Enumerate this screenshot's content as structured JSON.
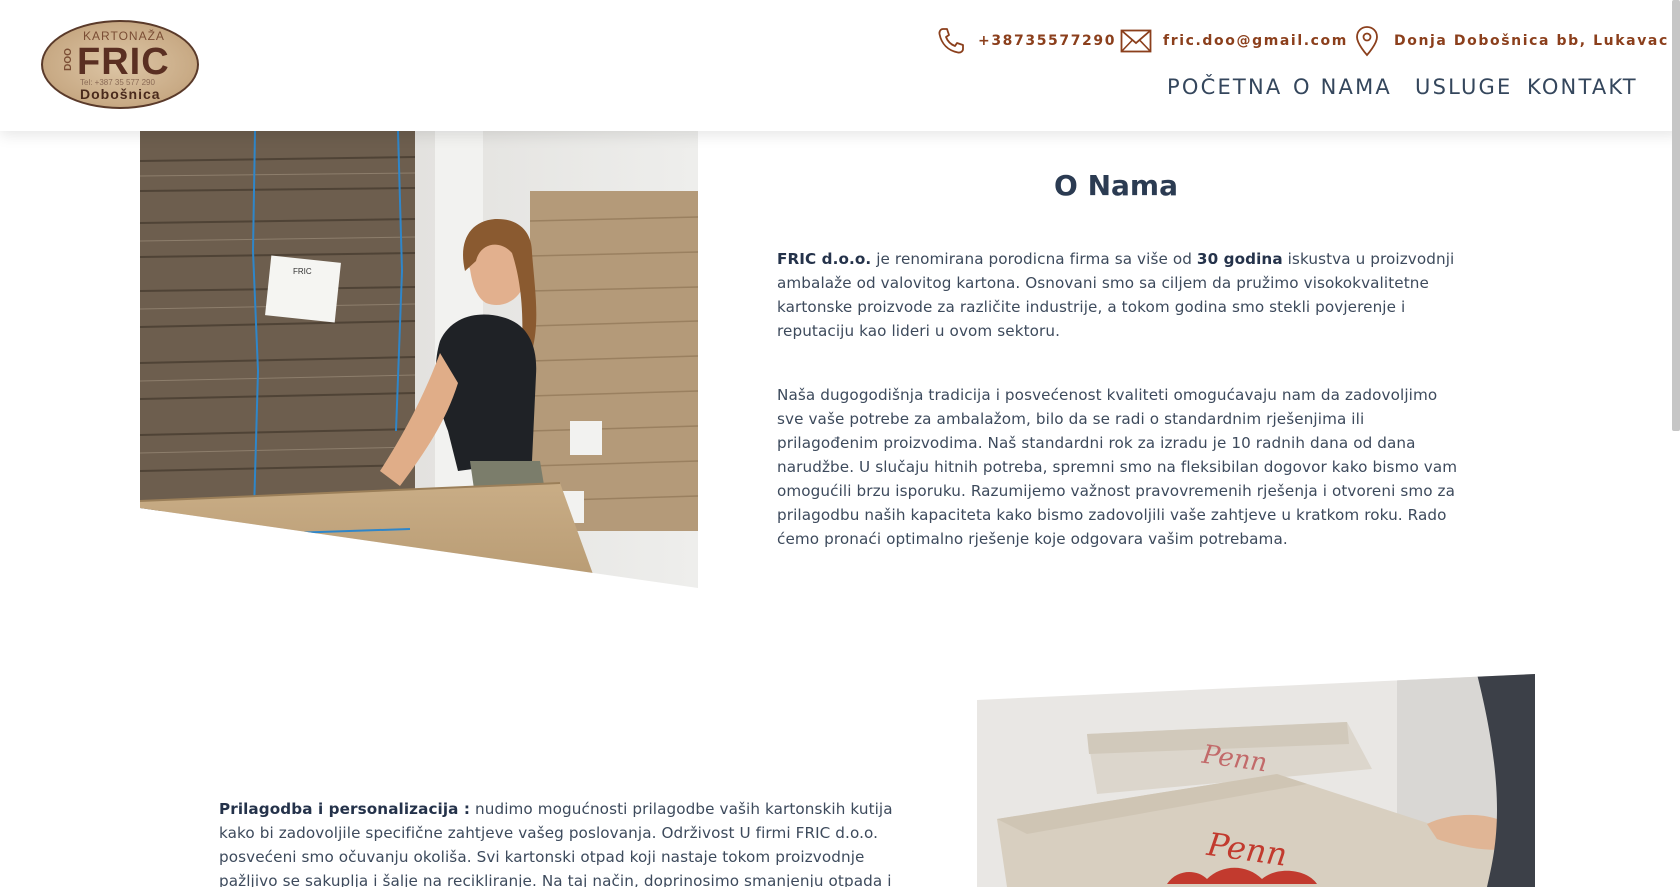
{
  "header": {
    "logo": {
      "top_text": "KARTONAŽA",
      "side_text": "DOO",
      "main_text": "FRIC",
      "tel_text": "Tel: +387 35 577 290",
      "bottom_text": "Dobošnica"
    },
    "contact": {
      "phone": "+38735577290",
      "email": "fric.doo@gmail.com",
      "address": "Donja Dobošnica bb, Lukavac"
    },
    "nav": [
      {
        "label": "POČETNA"
      },
      {
        "label": "O NAMA"
      },
      {
        "label": "USLUGE"
      },
      {
        "label": "KONTAKT"
      }
    ]
  },
  "about": {
    "title": "O Nama",
    "p1": {
      "company": "FRIC d.o.o.",
      "t1": " je renomirana porodicna firma sa više od ",
      "years": "30 godina",
      "t2": " iskustva u proizvodnji ambalaže od valovitog kartona. Osnovani smo sa ciljem da pružimo visokokvalitetne kartonske proizvode za različite industrije, a tokom godina smo stekli povjerenje i reputaciju kao lideri u ovom sektoru."
    },
    "p2": "Naša dugogodišnja tradicija i posvećenost kvaliteti omogućavaju nam da zadovoljimo sve vaše potrebe za ambalažom, bilo da se radi o standardnim rješenjima ili prilagođenim proizvodima. Naš standardni rok za izradu je 10 radnih dana od dana narudžbe. U slučaju hitnih potreba, spremni smo na fleksibilan dogovor kako bismo vam omogućili brzu isporuku. Razumijemo važnost pravovremenih rješenja i otvoreni smo za prilagodbu naših kapaciteta kako bismo zadovoljili vaše zahtjeve u kratkom roku. Rado ćemo pronaći optimalno rješenje koje odgovara vašim potrebama."
  },
  "custom": {
    "lead": "Prilagodba i personalizacija :",
    "text": " nudimo mogućnosti prilagodbe vaših kartonskih kutija kako bi zadovoljile specifične zahtjeve vašeg poslovanja. Održivost U firmi FRIC d.o.o. posvećeni smo očuvanju okoliša. Svi kartonski otpad koji nastaje tokom proizvodnje pažljivo se sakuplja i šalje na recikliranje. Na taj način, doprinosimo smanjenju otpada i promoviramo održivost u"
  },
  "photos": {
    "photo1": {
      "label_text": "FRIC"
    },
    "photo2": {
      "box_brand": "Penn"
    }
  },
  "colors": {
    "accent": "#8b3f1c",
    "nav": "#34465c",
    "title": "#2b3b52",
    "body": "#3d4a5c"
  },
  "icons": {
    "phone": "phone-icon",
    "email": "envelope-icon",
    "address": "map-pin-icon"
  }
}
